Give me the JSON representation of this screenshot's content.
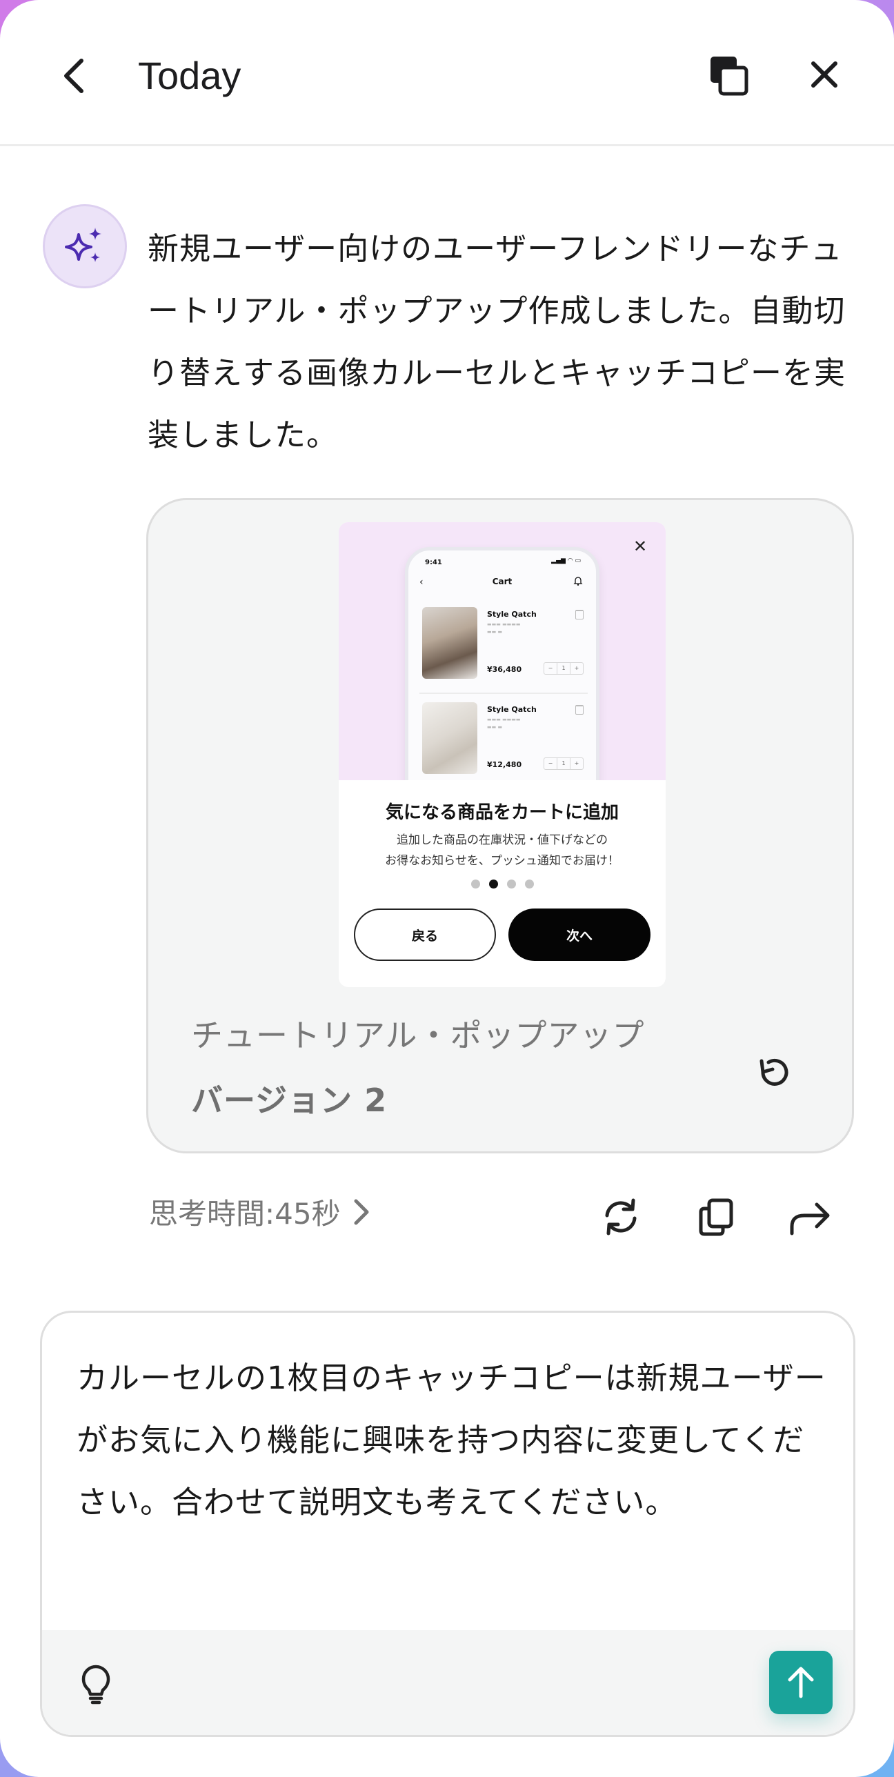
{
  "header": {
    "title": "Today"
  },
  "assistant": {
    "message": "新規ユーザー向けのユーザーフレンドリーなチュートリアル・ポップアップ作成しました。自動切り替えする画像カルーセルとキャッチコピーを実装しました。"
  },
  "preview": {
    "phone": {
      "time": "9:41",
      "title": "Cart",
      "items": [
        {
          "name": "Style Qatch",
          "price": "¥36,480",
          "qty": "1"
        },
        {
          "name": "Style Qatch",
          "price": "¥12,480",
          "qty": "1"
        }
      ]
    },
    "popup": {
      "heading": "気になる商品をカートに追加",
      "desc_line1": "追加した商品の在庫状況・値下げなどの",
      "desc_line2": "お得なお知らせを、プッシュ通知でお届け！",
      "back_label": "戻る",
      "next_label": "次へ",
      "dots_total": 4,
      "dots_active": 2
    },
    "label": "チュートリアル・ポップアップ",
    "version": "バージョン 2"
  },
  "meta": {
    "thinking_time": "思考時間:45秒"
  },
  "composer": {
    "text": "カルーセルの1枚目のキャッチコピーは新規ユーザーがお気に入り機能に興味を持つ内容に変更してください。合わせて説明文も考えてください。"
  },
  "colors": {
    "accent": "#1aa39a",
    "avatar_bg": "#ece3f8",
    "sparkle": "#4b2bb0",
    "popup_top_bg": "#f5e6f9"
  },
  "icons": {
    "back": "chevron-left-icon",
    "pip": "picture-in-picture-icon",
    "close": "close-icon",
    "assistant": "sparkles-icon",
    "undo": "undo-icon",
    "regenerate": "refresh-icon",
    "copy": "copy-icon",
    "share": "share-arrow-icon",
    "bulb": "lightbulb-icon",
    "send": "arrow-up-icon"
  }
}
